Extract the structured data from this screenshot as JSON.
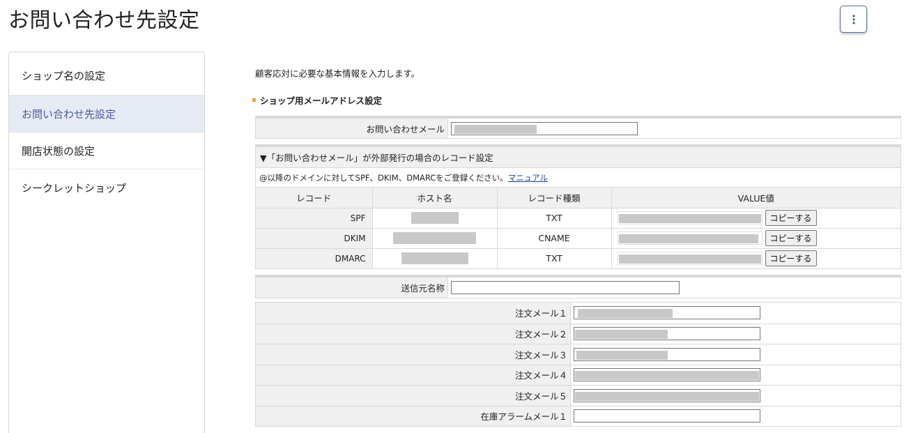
{
  "page": {
    "title": "お問い合わせ先設定"
  },
  "header": {
    "menu_icon": "kebab-menu-icon"
  },
  "sidebar": {
    "items": [
      {
        "label": "ショップ名の設定",
        "active": false
      },
      {
        "label": "お問い合わせ先設定",
        "active": true
      },
      {
        "label": "開店状態の設定",
        "active": false
      },
      {
        "label": "シークレットショップ",
        "active": false
      }
    ]
  },
  "main": {
    "intro": "顧客応対に必要な基本情報を入力します。",
    "section_title": "ショップ用メールアドレス設定",
    "contact_mail": {
      "label": "お問い合わせメール",
      "value": ""
    },
    "records": {
      "header": "▼「お問い合わせメール」が外部発行の場合のレコード設定",
      "note": "@以降のドメインに対してSPF、DKIM、DMARCをご登録ください。",
      "manual_link": "マニュアル",
      "columns": [
        "レコード",
        "ホスト名",
        "レコード種類",
        "VALUE値"
      ],
      "rows": [
        {
          "record": "SPF",
          "type": "TXT",
          "copy_label": "コピーする"
        },
        {
          "record": "DKIM",
          "type": "CNAME",
          "copy_label": "コピーする"
        },
        {
          "record": "DMARC",
          "type": "TXT",
          "copy_label": "コピーする"
        }
      ]
    },
    "sender_name": {
      "label": "送信元名称",
      "value": ""
    },
    "order_mails": [
      {
        "label": "注文メール１"
      },
      {
        "label": "注文メール２"
      },
      {
        "label": "注文メール３"
      },
      {
        "label": "注文メール４"
      },
      {
        "label": "注文メール５"
      },
      {
        "label": "在庫アラームメール１"
      }
    ]
  },
  "colors": {
    "accent": "#4a5a9a",
    "active_bg": "#e6eaf5",
    "bullet": "#f0a030",
    "link": "#1a3ea0"
  }
}
